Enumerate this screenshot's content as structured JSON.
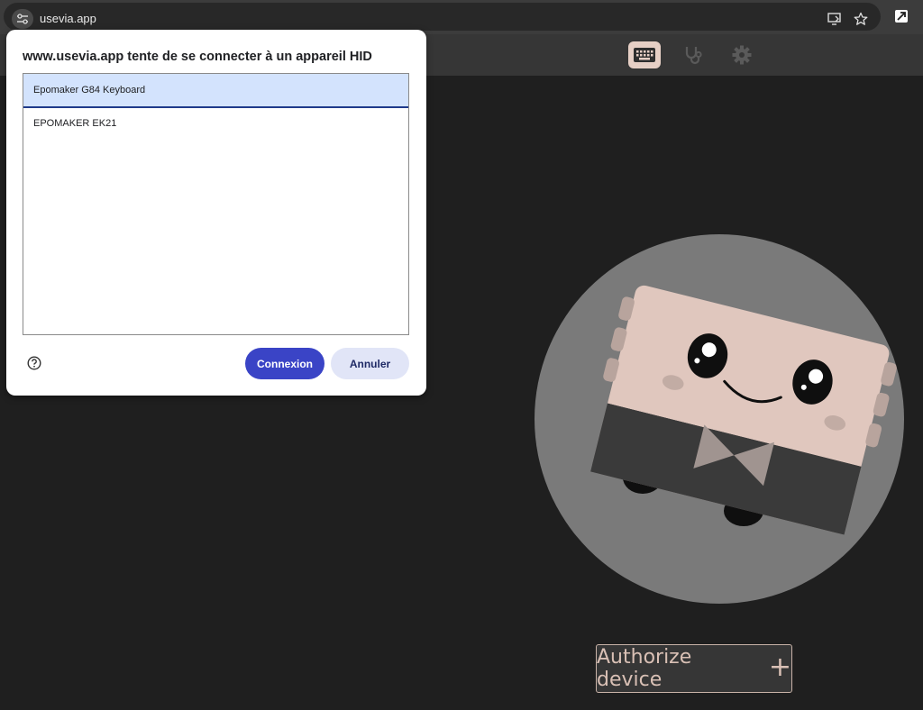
{
  "browser": {
    "url": "usevia.app"
  },
  "dialog": {
    "title": "www.usevia.app tente de se connecter à un appareil HID",
    "devices": [
      {
        "label": "Epomaker G84 Keyboard",
        "selected": true
      },
      {
        "label": "EPOMAKER EK21",
        "selected": false
      }
    ],
    "connect_label": "Connexion",
    "cancel_label": "Annuler"
  },
  "app": {
    "nav": [
      "keyboard-icon",
      "stethoscope-icon",
      "gear-icon"
    ],
    "authorize_label": "Authorize device",
    "authorize_icon": "+"
  },
  "colors": {
    "accent": "#3a44c6",
    "mascot_skin": "#e0c7be",
    "background": "#1f1f1f"
  }
}
